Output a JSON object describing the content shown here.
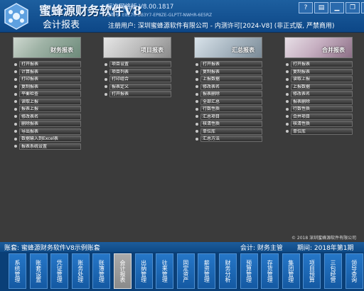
{
  "header": {
    "app_title": "蜜蜂源财务软件V8",
    "edition": "标准网络版 V8.00.1817",
    "serial": "序列号: E8Z76-UB3Y7-EP8ZE-GLPTT-NWHR-6E5RZ",
    "module_title": "会计报表",
    "registration": "注册用户: 深圳蜜蜂源软件有限公司 - 内测许可[2024-V8] (非正式版, 严禁商用)",
    "window_icons": [
      "help-icon",
      "window-icon",
      "minimize-icon",
      "restore-icon",
      "close-icon"
    ]
  },
  "columns": [
    {
      "thumb_label": "财务报表",
      "items": [
        "打开报表",
        "计算报表",
        "打印报表",
        "复制报表",
        "平衡检查",
        "读取上报",
        "报表上报",
        "修改表名",
        "删除报表",
        "导出报表",
        "数据输入到Excel表",
        "报表系统设置"
      ]
    },
    {
      "thumb_label": "项目报表",
      "items": [
        "项目设置",
        "项目列表",
        "打印组合",
        "报表定义",
        "打开报表"
      ]
    },
    {
      "thumb_label": "汇总报表",
      "items": [
        "打开报表",
        "复制报表",
        "上报数据",
        "修改表名",
        "报表删除",
        "全部汇总",
        "行数性质",
        "汇总项目",
        "核清性质",
        "单位库",
        "汇总方法"
      ]
    },
    {
      "thumb_label": "合并报表",
      "items": [
        "打开报表",
        "复制报表",
        "读取上报",
        "上报数据",
        "修改表名",
        "报表删除",
        "行数性质",
        "合并项目",
        "核清性质",
        "单位库"
      ]
    }
  ],
  "copyright": "© 2018 深圳蜜蜂源软件有限公司",
  "status": {
    "account": "账套: 蜜蜂源财务软件V8示例账套",
    "accountant": "会计: 财务主管",
    "period": "期间: 2018年第1期"
  },
  "nav": {
    "active_index": 6,
    "items": [
      "系统管理",
      "账套设置",
      "凭证管理",
      "账务处理",
      "账簿管理",
      "会计报表",
      "出纳管理",
      "往来管理",
      "固定资产",
      "薪资管理",
      "财务分析",
      "预算管理",
      "存货管理",
      "集团管理",
      "项目预算",
      "三包经营",
      "领导查询"
    ]
  },
  "colors": {
    "header_blue": "#1d5f9f",
    "nav_blue": "#2677c8",
    "active_gray": "#9a9a9a",
    "background": "#3b3b3b"
  }
}
